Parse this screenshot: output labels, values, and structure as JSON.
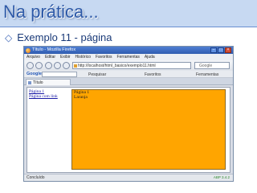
{
  "slide": {
    "title": "Na prática...",
    "bullet": "Exemplo 11 - página"
  },
  "window": {
    "title": "Título - Mozilla Firefox"
  },
  "menu": [
    "Arquivo",
    "Editar",
    "Exibir",
    "Histórico",
    "Favoritos",
    "Ferramentas",
    "Ajuda"
  ],
  "address": {
    "url": "http://localhost/html_basico/exemplo11.html"
  },
  "search": {
    "label": "Google"
  },
  "toolbar": {
    "google": "Google",
    "pesquisar": "Pesquisar",
    "favoritos": "Favoritos",
    "ferramentas": "Ferramentas"
  },
  "tab": {
    "label": "Título"
  },
  "left_frame": {
    "links": [
      "Página 1",
      "Página com link"
    ]
  },
  "right_frame": {
    "lines": [
      "Página 1",
      "Laranja"
    ]
  },
  "status": {
    "text": "Concluído",
    "right": "ABP 3.4.2"
  }
}
